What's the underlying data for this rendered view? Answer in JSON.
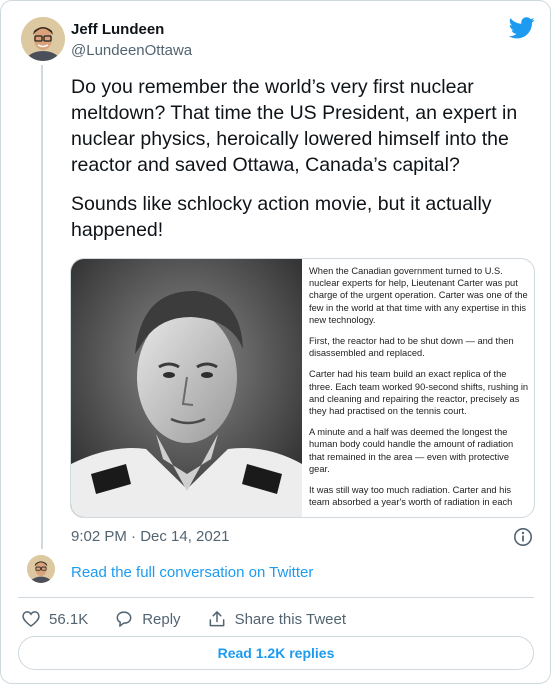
{
  "author": {
    "name": "Jeff Lundeen",
    "handle": "@LundeenOttawa"
  },
  "tweet": {
    "paragraphs": [
      "Do you remember the world’s very first nuclear meltdown? That time the US President, an expert in nuclear physics, heroically lowered himself into the reactor and saved Ottawa, Canada’s capital?",
      "Sounds like schlocky action movie, but it actually happened!"
    ],
    "timestamp": "9:02 PM · Dec 14, 2021"
  },
  "media": {
    "excerpt": [
      "When the Canadian government turned to U.S. nuclear experts for help, Lieutenant Carter was put charge of the urgent operation.  Carter was one of the few in the world at that time with any expertise in this new technology.",
      "First, the reactor had to be shut down — and then disassembled and replaced.",
      "Carter had his team build an exact replica of the three. Each team worked 90-second shifts, rushing in and cleaning and repairing the reactor, precisely as they had practised on the tennis court.",
      "A minute and a half was deemed the longest the human body could handle the amount of radiation that remained in the area — even with protective gear.",
      "It was still way too much radiation.  Carter and his team absorbed a year's worth of radiation in each"
    ]
  },
  "conversation_link": "Read the full conversation on Twitter",
  "actions": {
    "likes": "56.1K",
    "reply_label": "Reply",
    "share_label": "Share this Tweet"
  },
  "replies_button": "Read 1.2K replies",
  "icons": {
    "bird": "twitter-bird-icon",
    "info": "info-icon",
    "like": "heart-icon",
    "reply": "reply-bubble-icon",
    "share": "share-upload-icon"
  },
  "colors": {
    "accent": "#1d9bf0",
    "muted": "#536471",
    "border": "#cfd9de",
    "text": "#0f1419"
  }
}
